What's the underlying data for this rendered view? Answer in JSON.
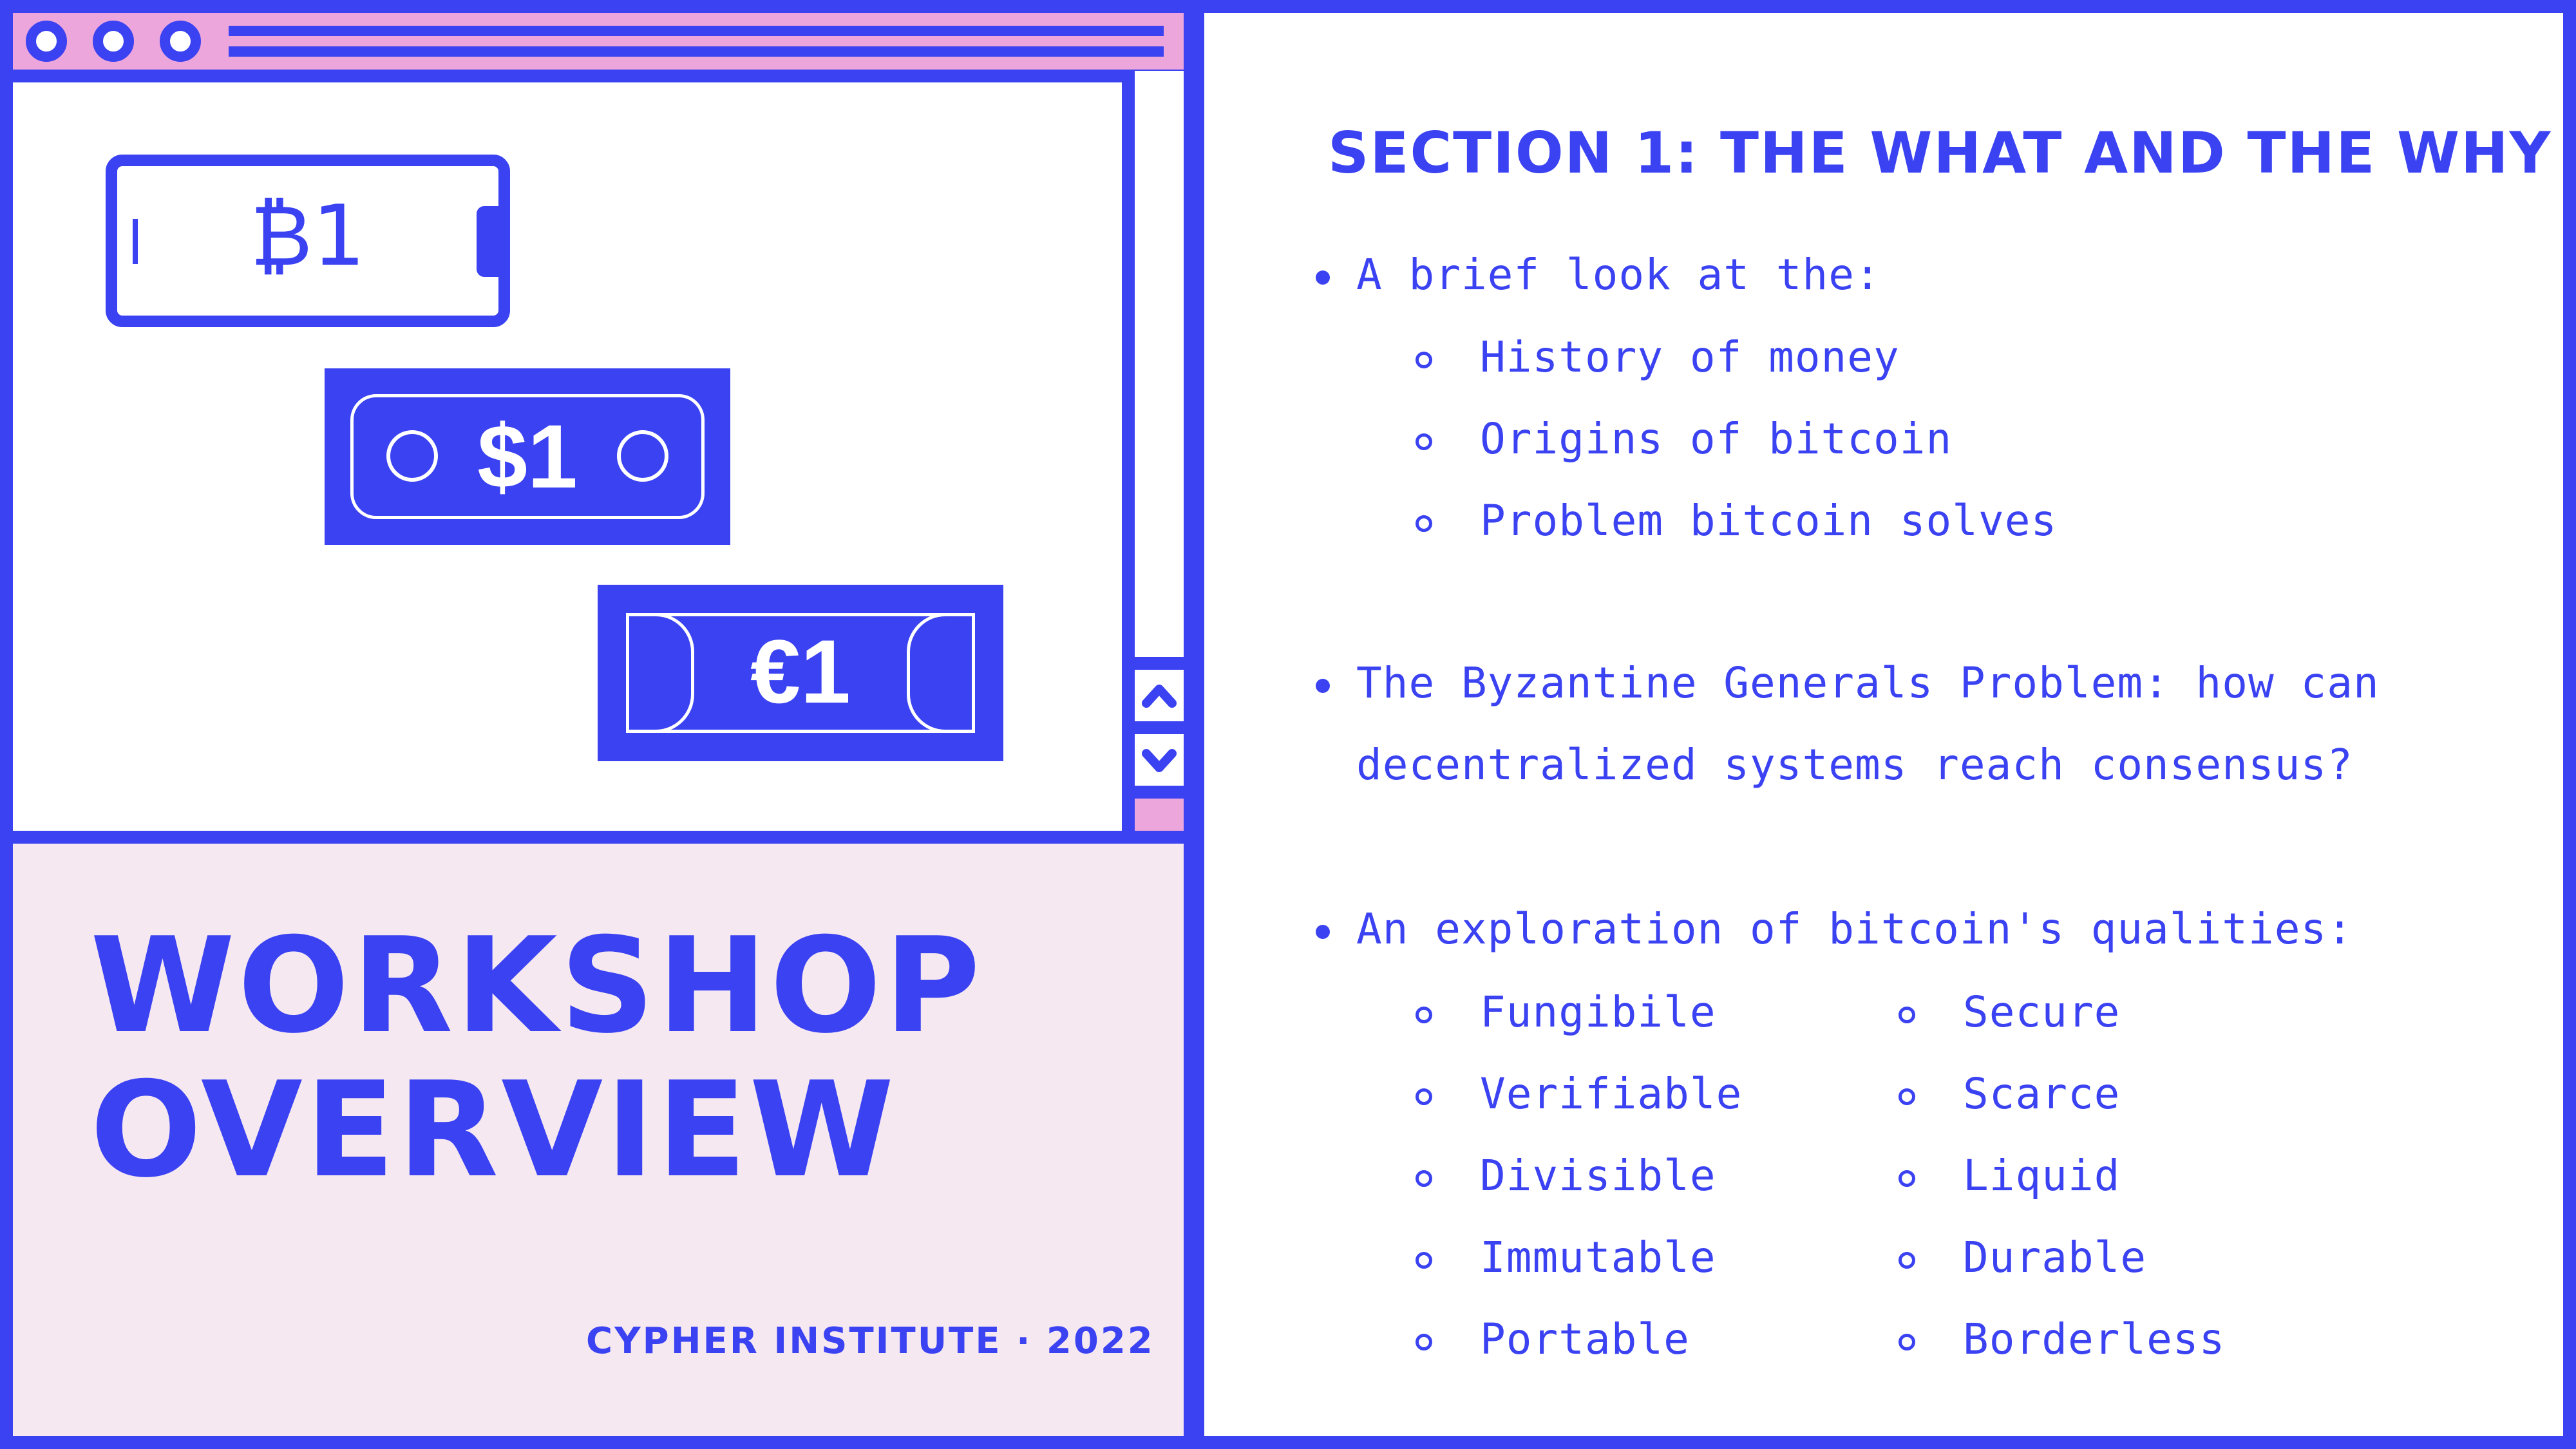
{
  "window": {
    "titlebar_icons": [
      "window-dot-icon",
      "window-dot-icon",
      "window-dot-icon"
    ]
  },
  "currency_cards": {
    "bitcoin": "₿1",
    "dollar": "$1",
    "euro": "€1"
  },
  "overview": {
    "title_line1": "WORKSHOP",
    "title_line2": "OVERVIEW",
    "credit": "CYPHER INSTITUTE · 2022"
  },
  "section": {
    "title": "SECTION 1: THE WHAT AND THE WHY",
    "bullets": [
      {
        "text": "A brief look at the:",
        "subitems": [
          "History of money",
          "Origins of bitcoin",
          "Problem bitcoin solves"
        ]
      },
      {
        "text_line1": "The Byzantine Generals Problem: how can",
        "text_line2": "decentralized systems reach consensus?"
      },
      {
        "text": "An exploration of bitcoin's qualities:",
        "qualities_left": [
          "Fungibile",
          "Verifiable",
          "Divisible",
          "Immutable",
          "Portable"
        ],
        "qualities_right": [
          "Secure",
          "Scarce",
          "Liquid",
          "Durable",
          "Borderless"
        ]
      }
    ]
  },
  "colors": {
    "accent": "#3a42f2",
    "pink": "#eca6dc",
    "panel_bg": "#f6e8f1"
  }
}
